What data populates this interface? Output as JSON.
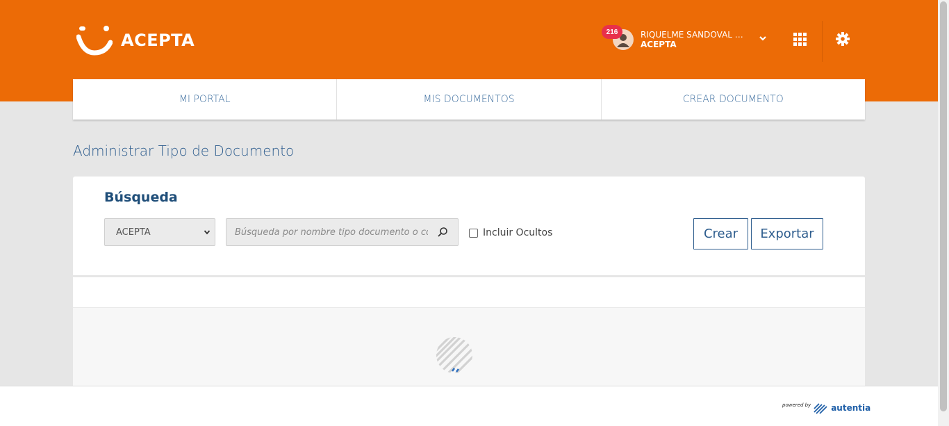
{
  "brand": {
    "name": "ACEPTA"
  },
  "user": {
    "notifications": "216",
    "name": "RIQUELME SANDOVAL RU...",
    "company": "ACEPTA"
  },
  "nav": {
    "tabs": [
      {
        "label": "MI PORTAL"
      },
      {
        "label": "MIS DOCUMENTOS"
      },
      {
        "label": "CREAR DOCUMENTO"
      }
    ]
  },
  "page": {
    "title": "Administrar Tipo de Documento"
  },
  "search": {
    "title": "Búsqueda",
    "company_select": "ACEPTA",
    "input_placeholder": "Búsqueda por nombre tipo documento o código",
    "include_hidden_label": "Incluir Ocultos",
    "create_label": "Crear",
    "export_label": "Exportar"
  },
  "footer": {
    "powered_by": "powered by",
    "vendor": "autentia"
  },
  "colors": {
    "brand": "#ec6b06",
    "accent": "#2e5d8e",
    "badge": "#e8304b"
  }
}
